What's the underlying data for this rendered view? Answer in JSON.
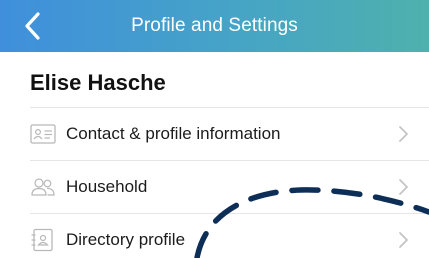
{
  "header": {
    "title": "Profile and Settings",
    "back_icon": "chevron-left-icon",
    "gradient_start": "#3f8fdc",
    "gradient_end": "#4fb1ad"
  },
  "user": {
    "name": "Elise Hasche"
  },
  "menu": {
    "items": [
      {
        "label": "Contact & profile information",
        "icon": "id-card-icon"
      },
      {
        "label": "Household",
        "icon": "people-icon"
      },
      {
        "label": "Directory profile",
        "icon": "address-book-icon"
      }
    ],
    "chevron_icon": "chevron-right-icon"
  },
  "colors": {
    "annotation_stroke": "#0d2e57",
    "icon_gray": "#b8b8b8",
    "chevron_gray": "#c4c4c4"
  }
}
